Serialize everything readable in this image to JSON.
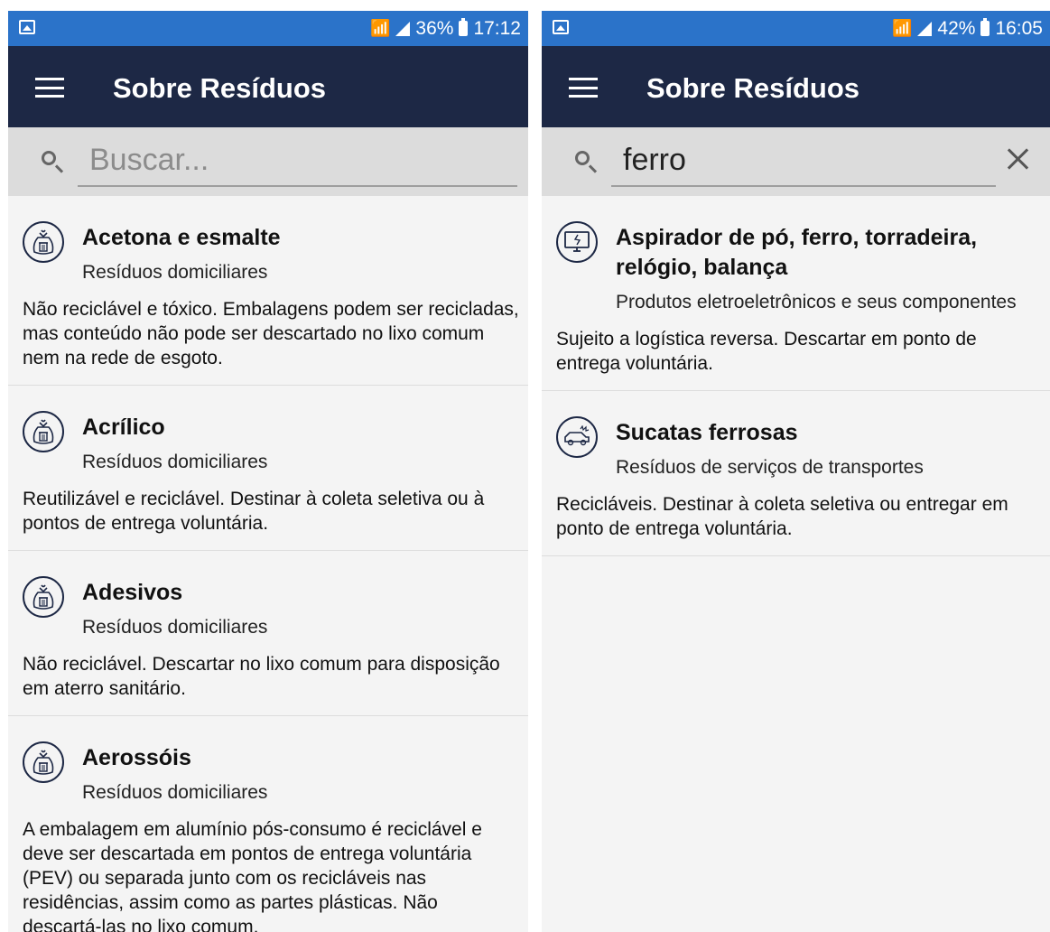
{
  "left_screen": {
    "status": {
      "battery": "36%",
      "time": "17:12"
    },
    "appbar": {
      "title": "Sobre Resíduos"
    },
    "search": {
      "placeholder": "Buscar...",
      "value": ""
    },
    "items": [
      {
        "name": "Acetona e esmalte",
        "category": "Resíduos domiciliares",
        "description": "Não reciclável e tóxico. Embalagens podem ser recicladas, mas conteúdo não pode ser descartado no lixo comum nem na rede de esgoto.",
        "icon": "trash-bag-icon"
      },
      {
        "name": "Acrílico",
        "category": "Resíduos domiciliares",
        "description": "Reutilizável e reciclável. Destinar à coleta seletiva ou à pontos de entrega voluntária.",
        "icon": "trash-bag-icon"
      },
      {
        "name": "Adesivos",
        "category": "Resíduos domiciliares",
        "description": "Não reciclável. Descartar no lixo comum para disposição em aterro sanitário.",
        "icon": "trash-bag-icon"
      },
      {
        "name": "Aerossóis",
        "category": "Resíduos domiciliares",
        "description": "A embalagem em alumínio pós-consumo é reciclável e deve ser descartada em pontos de entrega voluntária (PEV) ou separada junto com os recicláveis nas residências, assim como as partes plásticas. Não descartá-las no lixo comum.",
        "icon": "trash-bag-icon"
      }
    ]
  },
  "right_screen": {
    "status": {
      "battery": "42%",
      "time": "16:05"
    },
    "appbar": {
      "title": "Sobre Resíduos"
    },
    "search": {
      "placeholder": "Buscar...",
      "value": "ferro"
    },
    "items": [
      {
        "name": "Aspirador de pó, ferro, torradeira, relógio, balança",
        "category": "Produtos eletroeletrônicos e seus componentes",
        "description": "Sujeito a logística reversa. Descartar em ponto de entrega voluntária.",
        "icon": "broken-monitor-icon"
      },
      {
        "name": "Sucatas ferrosas",
        "category": "Resíduos de serviços de transportes",
        "description": "Recicláveis. Destinar à coleta seletiva ou entregar em ponto de entrega voluntária.",
        "icon": "crashed-car-icon"
      }
    ]
  },
  "colors": {
    "status_bar": "#2b73c9",
    "app_bar": "#1d2845",
    "search_bar": "#dcdcdc",
    "list_background": "#f4f4f4"
  }
}
